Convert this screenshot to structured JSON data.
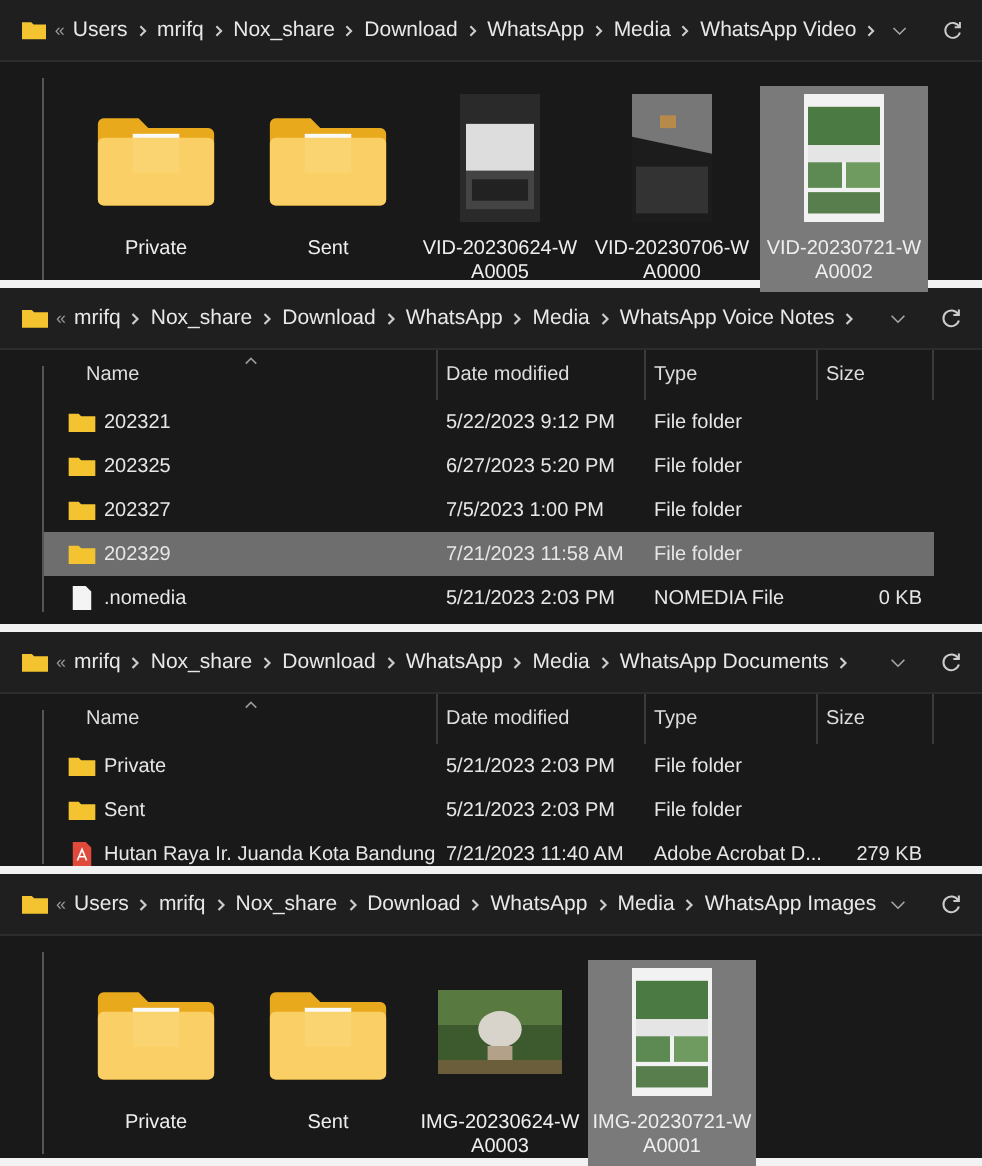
{
  "panels": [
    {
      "kind": "icons",
      "overflow": "«",
      "path": [
        "Users",
        "mrifq",
        "Nox_share",
        "Download",
        "WhatsApp",
        "Media",
        "WhatsApp Video"
      ],
      "trailing_chevron": true,
      "items": [
        {
          "kind": "folder",
          "name": "Private",
          "selected": false
        },
        {
          "kind": "folder",
          "name": "Sent",
          "selected": false
        },
        {
          "kind": "picture",
          "name": "VID-20230624-W\nA0005",
          "selected": false
        },
        {
          "kind": "picture",
          "name": "VID-20230706-W\nA0000",
          "selected": false
        },
        {
          "kind": "picture",
          "name": "VID-20230721-W\nA0002",
          "selected": true
        }
      ]
    },
    {
      "kind": "details",
      "overflow": "«",
      "path": [
        "mrifq",
        "Nox_share",
        "Download",
        "WhatsApp",
        "Media",
        "WhatsApp Voice Notes"
      ],
      "trailing_chevron": true,
      "columns": [
        "Name",
        "Date modified",
        "Type",
        "Size"
      ],
      "rows": [
        {
          "kind": "folder",
          "name": "202321",
          "date": "5/22/2023 9:12 PM",
          "type": "File folder",
          "selected": false
        },
        {
          "kind": "folder",
          "name": "202325",
          "date": "6/27/2023 5:20 PM",
          "type": "File folder",
          "selected": false
        },
        {
          "kind": "folder",
          "name": "202327",
          "date": "7/5/2023 1:00 PM",
          "type": "File folder",
          "selected": false
        },
        {
          "kind": "folder",
          "name": "202329",
          "date": "7/21/2023 11:58 AM",
          "type": "File folder",
          "selected": true
        },
        {
          "kind": "file",
          "name": ".nomedia",
          "date": "5/21/2023 2:03 PM",
          "type": "NOMEDIA File",
          "size": "0 KB",
          "selected": false
        }
      ]
    },
    {
      "kind": "details",
      "overflow": "«",
      "path": [
        "mrifq",
        "Nox_share",
        "Download",
        "WhatsApp",
        "Media",
        "WhatsApp Documents"
      ],
      "trailing_chevron": true,
      "columns": [
        "Name",
        "Date modified",
        "Type",
        "Size"
      ],
      "rows": [
        {
          "kind": "folder",
          "name": "Private",
          "date": "5/21/2023 2:03 PM",
          "type": "File folder",
          "selected": false
        },
        {
          "kind": "folder",
          "name": "Sent",
          "date": "5/21/2023 2:03 PM",
          "type": "File folder",
          "selected": false
        },
        {
          "kind": "pdf",
          "name": "Hutan Raya Ir. Juanda Kota Bandung",
          "date": "7/21/2023 11:40 AM",
          "type": "Adobe Acrobat D...",
          "size": "279 KB",
          "selected": false
        }
      ]
    },
    {
      "kind": "icons",
      "overflow": "«",
      "path": [
        "Users",
        "mrifq",
        "Nox_share",
        "Download",
        "WhatsApp",
        "Media",
        "WhatsApp Images"
      ],
      "trailing_chevron": false,
      "items": [
        {
          "kind": "folder",
          "name": "Private",
          "selected": false
        },
        {
          "kind": "folder",
          "name": "Sent",
          "selected": false
        },
        {
          "kind": "picture",
          "name": "IMG-20230624-W\nA0003",
          "selected": false
        },
        {
          "kind": "picture",
          "name": "IMG-20230721-W\nA0001",
          "selected": true
        }
      ]
    }
  ]
}
